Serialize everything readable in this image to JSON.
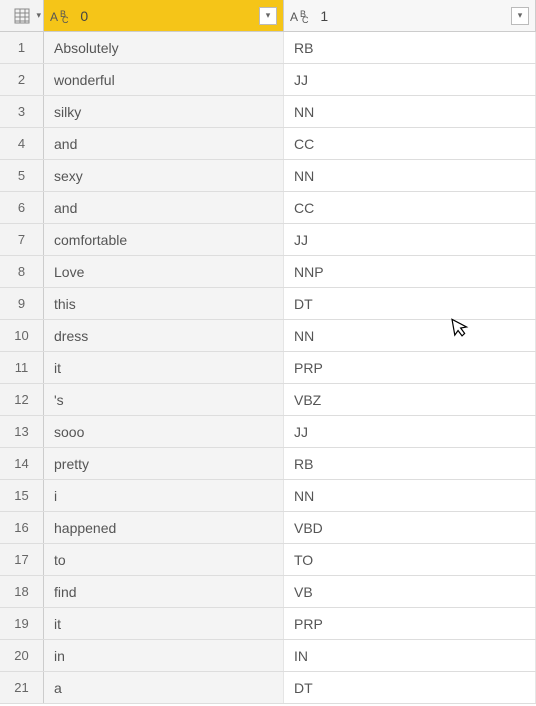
{
  "columns": [
    {
      "type_label": "ABC",
      "name": "0",
      "selected": true
    },
    {
      "type_label": "ABC",
      "name": "1",
      "selected": false
    }
  ],
  "rows": [
    {
      "num": "1",
      "c0": "Absolutely",
      "c1": "RB"
    },
    {
      "num": "2",
      "c0": "wonderful",
      "c1": "JJ"
    },
    {
      "num": "3",
      "c0": "silky",
      "c1": "NN"
    },
    {
      "num": "4",
      "c0": "and",
      "c1": "CC"
    },
    {
      "num": "5",
      "c0": "sexy",
      "c1": "NN"
    },
    {
      "num": "6",
      "c0": "and",
      "c1": "CC"
    },
    {
      "num": "7",
      "c0": "comfortable",
      "c1": "JJ"
    },
    {
      "num": "8",
      "c0": "Love",
      "c1": "NNP"
    },
    {
      "num": "9",
      "c0": "this",
      "c1": "DT"
    },
    {
      "num": "10",
      "c0": "dress",
      "c1": "NN"
    },
    {
      "num": "11",
      "c0": "it",
      "c1": "PRP"
    },
    {
      "num": "12",
      "c0": "'s",
      "c1": "VBZ"
    },
    {
      "num": "13",
      "c0": "sooo",
      "c1": "JJ"
    },
    {
      "num": "14",
      "c0": "pretty",
      "c1": "RB"
    },
    {
      "num": "15",
      "c0": "i",
      "c1": "NN"
    },
    {
      "num": "16",
      "c0": "happened",
      "c1": "VBD"
    },
    {
      "num": "17",
      "c0": "to",
      "c1": "TO"
    },
    {
      "num": "18",
      "c0": "find",
      "c1": "VB"
    },
    {
      "num": "19",
      "c0": "it",
      "c1": "PRP"
    },
    {
      "num": "20",
      "c0": "in",
      "c1": "IN"
    },
    {
      "num": "21",
      "c0": "a",
      "c1": "DT"
    }
  ]
}
